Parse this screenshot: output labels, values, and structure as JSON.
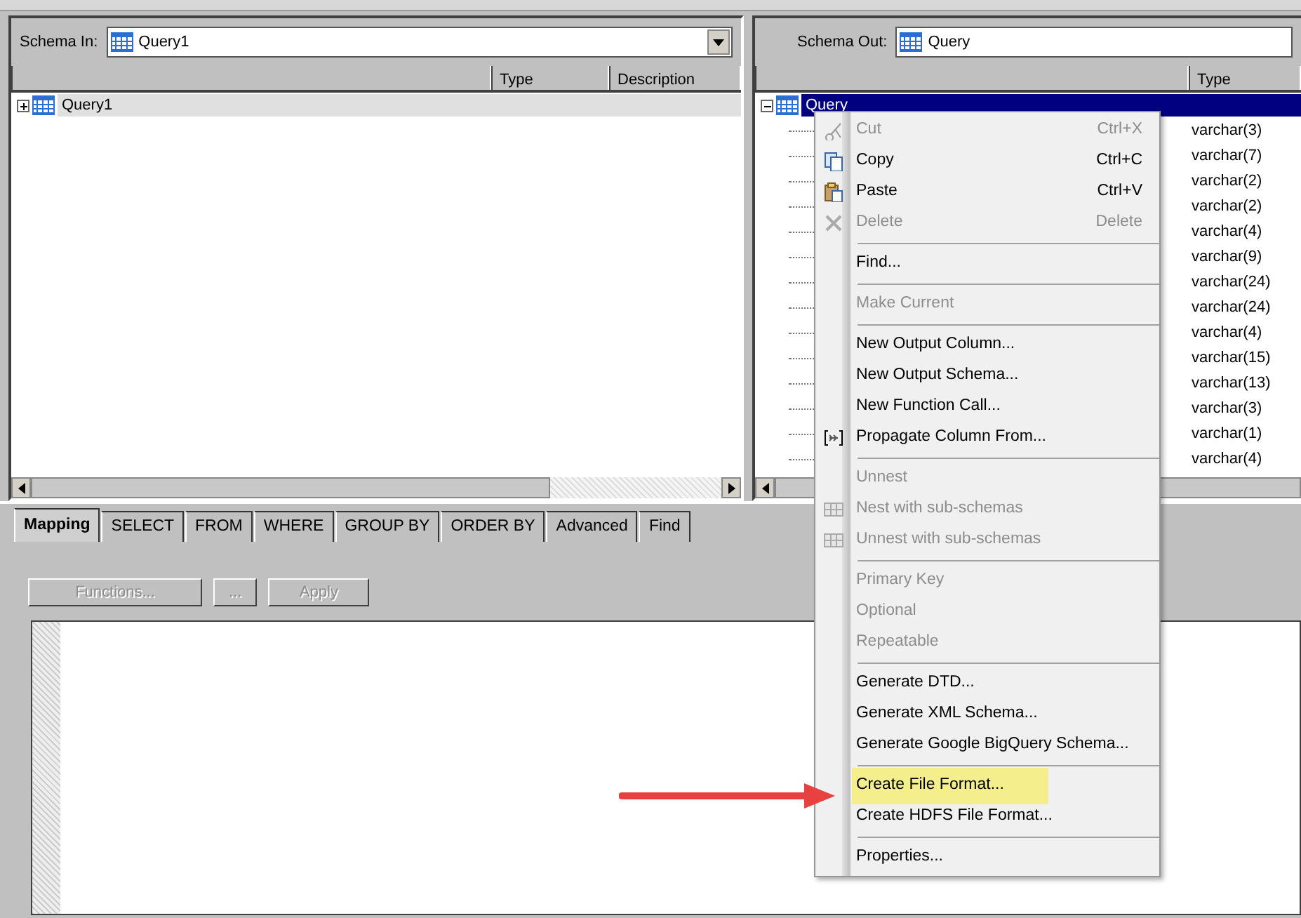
{
  "schema_in": {
    "label": "Schema In:",
    "value": "Query1",
    "focused": false,
    "columns": [
      "Type",
      "Description"
    ],
    "tree": [
      {
        "label": "Query1",
        "expanded": false,
        "selected": true
      }
    ]
  },
  "schema_out": {
    "label": "Schema Out:",
    "value": "Query",
    "focused": true,
    "columns": [
      "Type"
    ],
    "tree": [
      {
        "label": "Query",
        "expanded": true,
        "selected": true,
        "children": [
          {
            "type": "varchar(3)"
          },
          {
            "type": "varchar(7)"
          },
          {
            "type": "varchar(2)"
          },
          {
            "type": "varchar(2)"
          },
          {
            "type": "varchar(4)"
          },
          {
            "type": "varchar(9)"
          },
          {
            "type": "varchar(24)"
          },
          {
            "type": "varchar(24)"
          },
          {
            "type": "varchar(4)"
          },
          {
            "type": "varchar(15)"
          },
          {
            "type": "varchar(13)"
          },
          {
            "type": "varchar(3)"
          },
          {
            "type": "varchar(1)"
          },
          {
            "type": "varchar(4)"
          }
        ]
      }
    ]
  },
  "mapping": {
    "tabs": [
      {
        "label": "Mapping",
        "selected": true
      },
      {
        "label": "SELECT",
        "selected": false
      },
      {
        "label": "FROM",
        "selected": false
      },
      {
        "label": "WHERE",
        "selected": false
      },
      {
        "label": "GROUP BY",
        "selected": false
      },
      {
        "label": "ORDER BY",
        "selected": false
      },
      {
        "label": "Advanced",
        "selected": false
      },
      {
        "label": "Find",
        "selected": false
      }
    ],
    "buttons": [
      {
        "label": "Functions...",
        "disabled": true
      },
      {
        "label": "...",
        "disabled": true
      },
      {
        "label": "Apply",
        "disabled": true
      }
    ]
  },
  "context_menu": {
    "items": [
      {
        "kind": "item",
        "label": "Cut",
        "shortcut": "Ctrl+X",
        "disabled": true,
        "highlighted": false
      },
      {
        "kind": "item",
        "label": "Copy",
        "shortcut": "Ctrl+C",
        "disabled": false,
        "highlighted": false
      },
      {
        "kind": "item",
        "label": "Paste",
        "shortcut": "Ctrl+V",
        "disabled": false,
        "highlighted": false
      },
      {
        "kind": "item",
        "label": "Delete",
        "shortcut": "Delete",
        "disabled": true,
        "highlighted": false
      },
      {
        "kind": "separator"
      },
      {
        "kind": "item",
        "label": "Find...",
        "disabled": false,
        "highlighted": false
      },
      {
        "kind": "separator"
      },
      {
        "kind": "item",
        "label": "Make Current",
        "disabled": true,
        "highlighted": false
      },
      {
        "kind": "separator"
      },
      {
        "kind": "item",
        "label": "New Output Column...",
        "disabled": false,
        "highlighted": false
      },
      {
        "kind": "item",
        "label": "New Output Schema...",
        "disabled": false,
        "highlighted": false
      },
      {
        "kind": "item",
        "label": "New Function Call...",
        "disabled": false,
        "highlighted": false
      },
      {
        "kind": "item",
        "label": "Propagate Column From...",
        "disabled": false,
        "highlighted": false
      },
      {
        "kind": "separator"
      },
      {
        "kind": "item",
        "label": "Unnest",
        "disabled": true,
        "highlighted": false
      },
      {
        "kind": "item",
        "label": "Nest with sub-schemas",
        "disabled": true,
        "highlighted": false
      },
      {
        "kind": "item",
        "label": "Unnest with sub-schemas",
        "disabled": true,
        "highlighted": false
      },
      {
        "kind": "separator"
      },
      {
        "kind": "item",
        "label": "Primary Key",
        "disabled": true,
        "highlighted": false
      },
      {
        "kind": "item",
        "label": "Optional",
        "disabled": true,
        "highlighted": false
      },
      {
        "kind": "item",
        "label": "Repeatable",
        "disabled": true,
        "highlighted": false
      },
      {
        "kind": "separator"
      },
      {
        "kind": "item",
        "label": "Generate DTD...",
        "disabled": false,
        "highlighted": false
      },
      {
        "kind": "item",
        "label": "Generate XML Schema...",
        "disabled": false,
        "highlighted": false
      },
      {
        "kind": "item",
        "label": "Generate Google BigQuery Schema...",
        "disabled": false,
        "highlighted": false
      },
      {
        "kind": "separator"
      },
      {
        "kind": "item",
        "label": "Create File Format...",
        "disabled": false,
        "highlighted": true
      },
      {
        "kind": "item",
        "label": "Create HDFS File Format...",
        "disabled": false,
        "highlighted": false
      },
      {
        "kind": "separator"
      },
      {
        "kind": "item",
        "label": "Properties...",
        "disabled": false,
        "highlighted": false
      }
    ]
  }
}
